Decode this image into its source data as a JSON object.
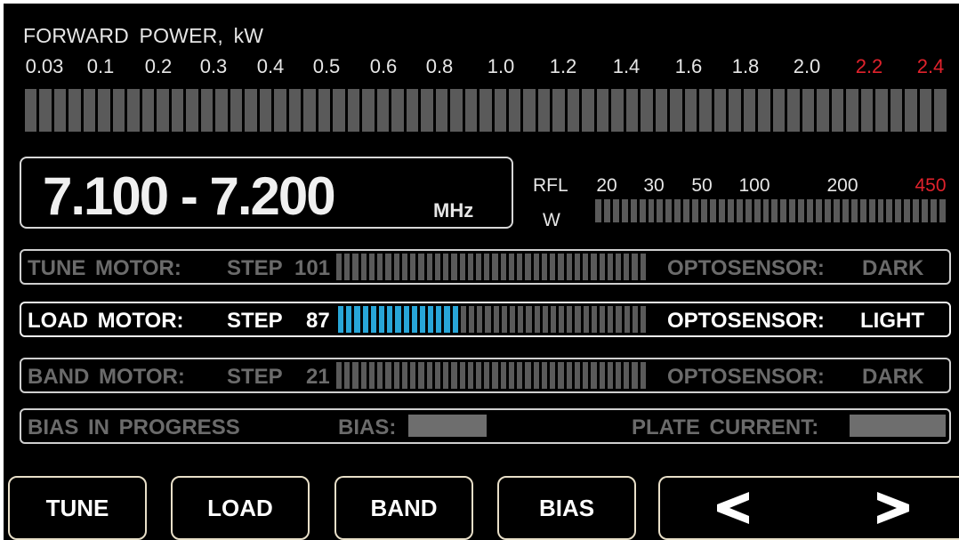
{
  "forward_power": {
    "label": "FORWARD  POWER, kW",
    "ticks": [
      {
        "label": "0.03",
        "red": false
      },
      {
        "label": "0.1",
        "red": false
      },
      {
        "label": "0.2",
        "red": false
      },
      {
        "label": "0.3",
        "red": false
      },
      {
        "label": "0.4",
        "red": false
      },
      {
        "label": "0.5",
        "red": false
      },
      {
        "label": "0.6",
        "red": false
      },
      {
        "label": "0.8",
        "red": false
      },
      {
        "label": "1.0",
        "red": false
      },
      {
        "label": "1.2",
        "red": false
      },
      {
        "label": "1.4",
        "red": false
      },
      {
        "label": "1.6",
        "red": false
      },
      {
        "label": "1.8",
        "red": false
      },
      {
        "label": "2.0",
        "red": false
      },
      {
        "label": "2.2",
        "red": true
      },
      {
        "label": "2.4",
        "red": true
      }
    ],
    "level_fraction": 0
  },
  "frequency": {
    "value": "7.100 - 7.200",
    "unit": "MHz"
  },
  "reflected": {
    "label": "RFL",
    "unit": "W",
    "ticks": [
      {
        "label": "20",
        "red": false
      },
      {
        "label": "30",
        "red": false
      },
      {
        "label": "50",
        "red": false
      },
      {
        "label": "100",
        "red": false
      },
      {
        "label": "200",
        "red": false
      },
      {
        "label": "450",
        "red": true
      }
    ],
    "level_fraction": 0
  },
  "tune_motor": {
    "label": "TUNE  MOTOR:",
    "step_label": "STEP",
    "step_value": "101",
    "optosensor_label": "OPTOSENSOR:",
    "optosensor_value": "DARK",
    "active": false,
    "level_fraction": 0
  },
  "load_motor": {
    "label": "LOAD  MOTOR:",
    "step_label": "STEP",
    "step_value": "87",
    "optosensor_label": "OPTOSENSOR:",
    "optosensor_value": "LIGHT",
    "active": true,
    "level_fraction": 0.4
  },
  "band_motor": {
    "label": "BAND  MOTOR:",
    "step_label": "STEP",
    "step_value": "21",
    "optosensor_label": "OPTOSENSOR:",
    "optosensor_value": "DARK",
    "active": false,
    "level_fraction": 0
  },
  "bias": {
    "status": "BIAS IN PROGRESS",
    "bias_label": "BIAS:",
    "plate_current_label": "PLATE  CURRENT:"
  },
  "buttons": {
    "tune": "TUNE",
    "load": "LOAD",
    "band": "BAND",
    "bias": "BIAS",
    "prev_icon": "chevron-left-icon",
    "next_icon": "chevron-right-icon"
  },
  "colors": {
    "background": "#000000",
    "segment_off": "#5a5a5a",
    "segment_on": "#28a6d8",
    "warning": "#e0222c"
  }
}
